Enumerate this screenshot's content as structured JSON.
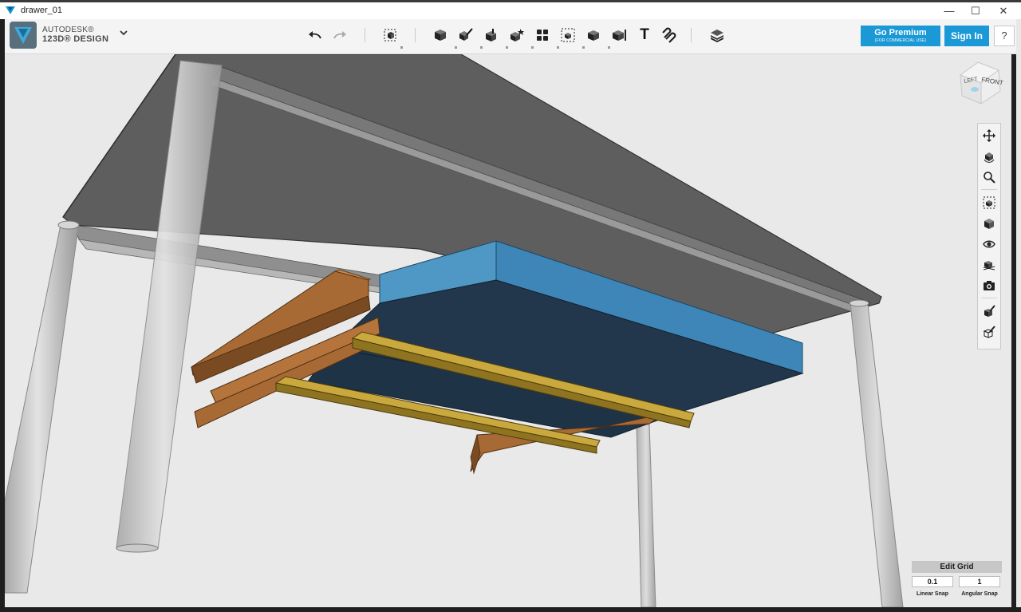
{
  "window": {
    "title": "drawer_01",
    "minimize_glyph": "—",
    "maximize_glyph": "☐",
    "close_glyph": "✕"
  },
  "brand": {
    "line1": "AUTODESK®",
    "line2": "123D® DESIGN",
    "logo_icon": "autodesk-123d-logo-icon",
    "menu_icon": "chevron-down-icon"
  },
  "toolbar": {
    "tools": [
      {
        "name": "undo-button",
        "icon": "undo-arrow-icon"
      },
      {
        "name": "redo-button",
        "icon": "redo-arrow-icon"
      },
      {
        "name": "transform-button",
        "icon": "transform-cube-icon"
      },
      {
        "name": "primitives-button",
        "icon": "cube-primitives-icon"
      },
      {
        "name": "sketch-button",
        "icon": "pencil-cube-icon"
      },
      {
        "name": "construct-button",
        "icon": "construct-cube-icon"
      },
      {
        "name": "modify-button",
        "icon": "modify-cube-icon"
      },
      {
        "name": "pattern-button",
        "icon": "pattern-grid-icon"
      },
      {
        "name": "group-button",
        "icon": "group-cubes-icon"
      },
      {
        "name": "combine-button",
        "icon": "combine-cube-icon"
      },
      {
        "name": "measure-button",
        "icon": "measure-cube-icon"
      },
      {
        "name": "text-button",
        "icon": "text-t-icon"
      },
      {
        "name": "snap-button",
        "icon": "magnet-icon"
      },
      {
        "name": "material-button",
        "icon": "layers-icon"
      }
    ],
    "text_tool_glyph": "T"
  },
  "buttons": {
    "premium_label": "Go Premium",
    "premium_sub": "(FOR COMMERCIAL USE)",
    "signin_label": "Sign In",
    "help_label": "?"
  },
  "viewcube": {
    "left_label": "LEFT",
    "front_label": "FRONT"
  },
  "navbar": {
    "items": [
      {
        "name": "pan-button",
        "icon": "pan-arrows-icon"
      },
      {
        "name": "orbit-button",
        "icon": "orbit-icon"
      },
      {
        "name": "zoom-button",
        "icon": "zoom-magnifier-icon"
      },
      {
        "name": "fit-button",
        "icon": "fit-cube-icon"
      },
      {
        "name": "view-mode-button",
        "icon": "shaded-cube-icon"
      },
      {
        "name": "visibility-button",
        "icon": "eye-icon"
      },
      {
        "name": "grid-visibility-button",
        "icon": "grid-cubes-icon"
      },
      {
        "name": "snapshot-button",
        "icon": "camera-icon"
      },
      {
        "name": "material-cube-button",
        "icon": "paint-cube-icon"
      },
      {
        "name": "outline-cube-button",
        "icon": "outline-cube-icon"
      }
    ]
  },
  "grid": {
    "edit_label": "Edit Grid",
    "linear_value": "0.1",
    "linear_label": "Linear Snap",
    "angular_value": "1",
    "angular_label": "Angular Snap"
  },
  "colors": {
    "accent": "#1a99d6",
    "table_top": "#5e5e5e",
    "drawer_blue_top": "#3e86b7",
    "drawer_blue_side": "#22374b",
    "wood_orange": "#a86a35",
    "wood_gold": "#b29231"
  }
}
